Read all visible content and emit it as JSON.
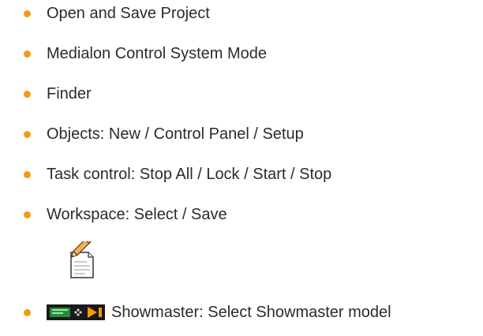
{
  "items": [
    {
      "label": "Open and Save Project"
    },
    {
      "label": "Medialon Control System Mode"
    },
    {
      "label": "Finder"
    },
    {
      "label": "Objects: New / Control Panel / Setup"
    },
    {
      "label": "Task control: Stop All / Lock / Start / Stop"
    },
    {
      "label": "Workspace: Select / Save"
    },
    {
      "label": "Showmaster: Select Showmaster model"
    }
  ],
  "icons": {
    "document": "document-pencil-icon",
    "device": "showmaster-device-icon"
  },
  "colors": {
    "bullet": "#f39c12",
    "text": "#2b2b2b",
    "device_screen": "#1f8f3a",
    "device_arrow": "#f59b00"
  }
}
